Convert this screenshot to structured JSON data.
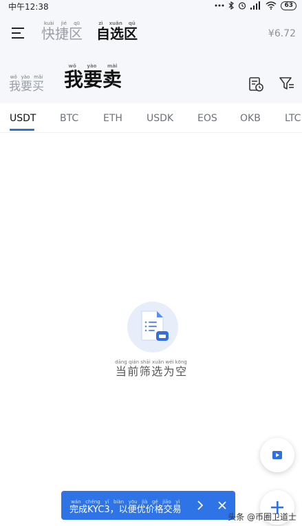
{
  "status_bar": {
    "time": "中午12:38",
    "battery": "63"
  },
  "nav": {
    "tabs": [
      {
        "label": "快捷区",
        "pinyin": "kuài jié qū"
      },
      {
        "label": "自选区",
        "pinyin": "zì xuǎn qū"
      }
    ],
    "price": "¥6.72"
  },
  "side": {
    "buy": {
      "label": "我要买",
      "pinyin": "wǒ yào mǎi"
    },
    "sell": {
      "label": "我要卖",
      "pinyin": "wǒ yào mài"
    }
  },
  "currencies": [
    "USDT",
    "BTC",
    "ETH",
    "USDK",
    "EOS",
    "OKB",
    "LTC"
  ],
  "active_currency": "USDT",
  "empty_state": {
    "text": "当前筛选为空",
    "pinyin": "dāng qián shāi xuǎn wéi kōng"
  },
  "kyc_banner": {
    "text": "完成KYC3，以便优价格交易",
    "pinyin": "wán chéng yǐ biàn yōu jià gé jiāo yì"
  },
  "watermark": "头条 @币圈卫道士",
  "colors": {
    "accent": "#2f6fdf",
    "banner": "#2f74e6",
    "header_bg": "#f5f7fa"
  },
  "icons": [
    "menu-icon",
    "order-history-icon",
    "filter-icon",
    "document-icon",
    "video-icon",
    "plus-icon",
    "chevron-right-icon",
    "close-icon"
  ]
}
